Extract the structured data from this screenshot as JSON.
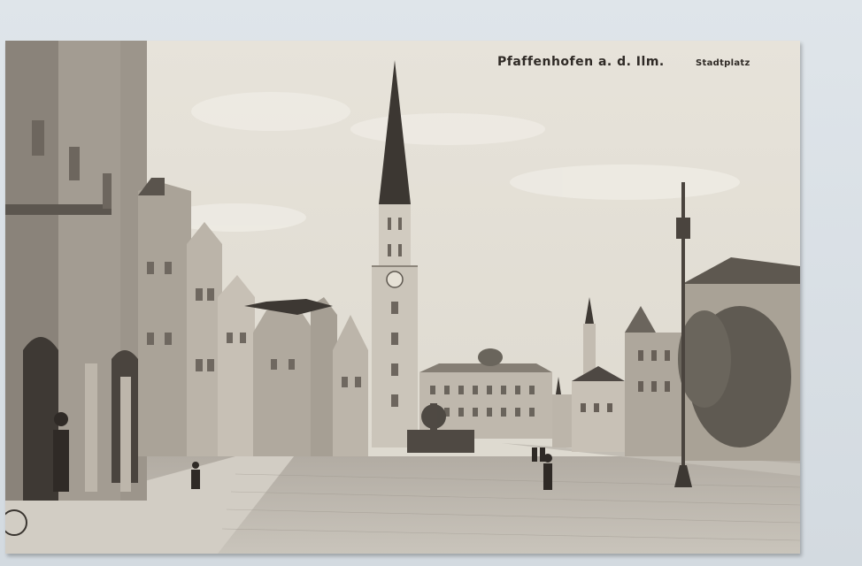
{
  "postcard": {
    "title": "Pfaffenhofen a. d. Ilm.",
    "place": "Stadtplatz"
  },
  "colors": {
    "sky": "#e6e1d6",
    "stone": "#b9b2a6",
    "dark": "#4a443e",
    "paper": "#e9e5dc"
  }
}
